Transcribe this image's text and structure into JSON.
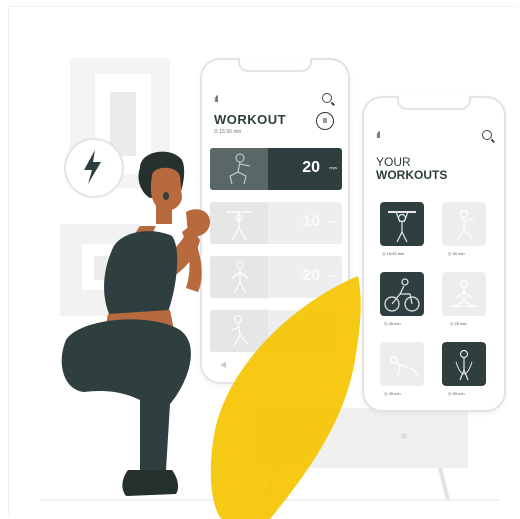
{
  "phone_workout": {
    "title": "WORKOUT",
    "duration": "⏱ 15:30 min",
    "pause": "II",
    "exercises": [
      {
        "count": "20",
        "unit": "reps"
      },
      {
        "count": "10",
        "unit": "reps"
      },
      {
        "count": "20",
        "unit": "reps"
      },
      {
        "count": "",
        "unit": ""
      }
    ],
    "nav": [
      "◀",
      "●",
      "■"
    ]
  },
  "phone_your_workouts": {
    "title_line1": "YOUR",
    "title_line2": "WORKOUTS",
    "tiles": [
      {
        "time": "◷ 15:30 min",
        "dark": true
      },
      {
        "time": "◷ 30 min",
        "dark": false
      },
      {
        "time": "◷ 45 min",
        "dark": true
      },
      {
        "time": "◷ 20 min",
        "dark": false
      },
      {
        "time": "◷ 45 min",
        "dark": false
      },
      {
        "time": "◷ 55 min",
        "dark": true
      }
    ]
  },
  "status_bars": "ıll",
  "colors": {
    "accent_yellow": "#f5c400",
    "dark_teal": "#2f3e3e",
    "skin": "#b66a3e",
    "pants": "#2f3e3e",
    "sports_top": "#2f3e3e"
  },
  "icons": [
    "lightning-icon",
    "search-icon",
    "pause-icon",
    "signal-icon",
    "clock-icon"
  ]
}
